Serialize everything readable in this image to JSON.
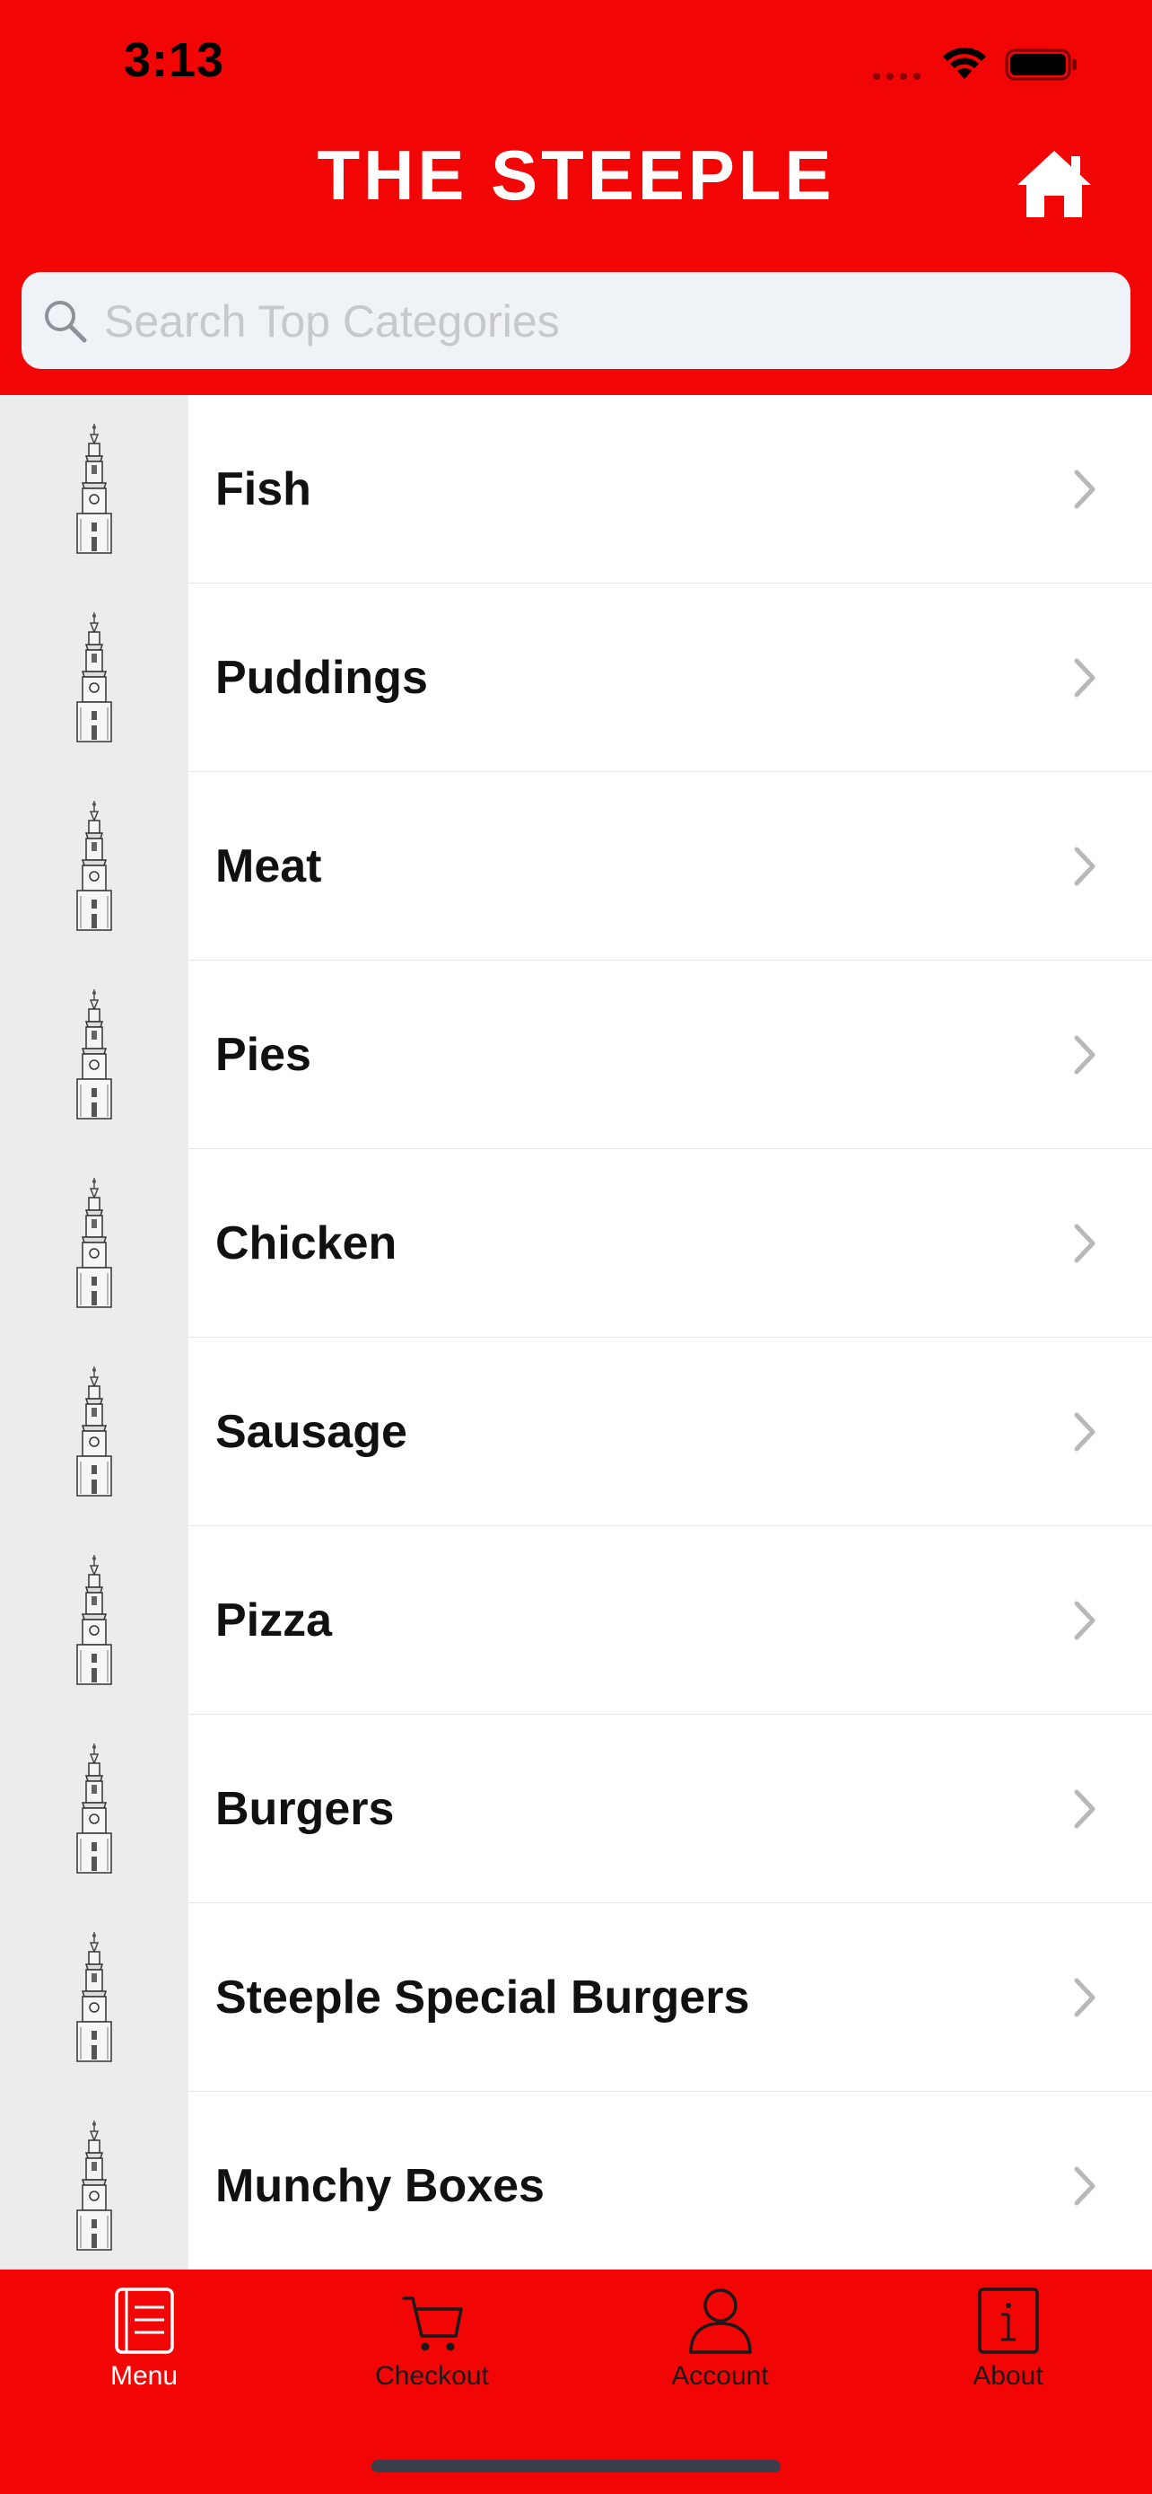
{
  "status_bar": {
    "time": "3:13"
  },
  "header": {
    "title": "THE STEEPLE",
    "home_icon": "home-icon",
    "background_color": "#f20505"
  },
  "search": {
    "placeholder": "Search Top Categories",
    "value": ""
  },
  "categories": [
    {
      "label": "Fish"
    },
    {
      "label": "Puddings"
    },
    {
      "label": "Meat"
    },
    {
      "label": "Pies"
    },
    {
      "label": "Chicken"
    },
    {
      "label": "Sausage"
    },
    {
      "label": "Pizza"
    },
    {
      "label": "Burgers"
    },
    {
      "label": "Steeple Special Burgers"
    },
    {
      "label": "Munchy Boxes"
    }
  ],
  "tabbar": {
    "tabs": [
      {
        "label": "Menu",
        "icon": "menu-icon",
        "active": true
      },
      {
        "label": "Checkout",
        "icon": "cart-icon",
        "active": false
      },
      {
        "label": "Account",
        "icon": "person-icon",
        "active": false
      },
      {
        "label": "About",
        "icon": "info-icon",
        "active": false
      }
    ]
  }
}
